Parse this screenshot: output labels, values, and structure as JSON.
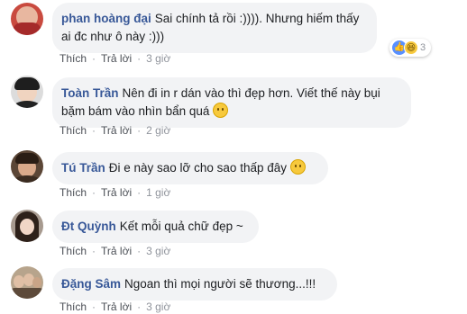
{
  "comments": [
    {
      "author": "phan hoàng đại",
      "text": "Sai chính tả rồi :)))). Nhưng hiếm thấy ai đc như ô này :)))",
      "like_label": "Thích",
      "reply_label": "Trả lời",
      "time": "3 giờ",
      "reaction_count": "3",
      "has_emoji": false,
      "avatar_color": "#b8352f"
    },
    {
      "author": "Toàn Trần",
      "text": "Nên đi in r dán vào thì đẹp hơn. Viết thế này bụi bặm bám vào nhìn bẩn quá",
      "like_label": "Thích",
      "reply_label": "Trả lời",
      "time": "2 giờ",
      "has_emoji": true,
      "avatar_color": "#2b2b2b"
    },
    {
      "author": "Tú Trần",
      "text": "Đi e này sao lỡ cho sao thấp đây",
      "like_label": "Thích",
      "reply_label": "Trả lời",
      "time": "1 giờ",
      "has_emoji": true,
      "avatar_color": "#6a4a3a"
    },
    {
      "author": "Đt Quỳnh",
      "text": "Kết mỗi quả chữ đẹp ~",
      "like_label": "Thích",
      "reply_label": "Trả lời",
      "time": "3 giờ",
      "has_emoji": false,
      "avatar_color": "#3c2b22"
    },
    {
      "author": "Đặng Sâm",
      "text": "Ngoan thì mọi người sẽ thương...!!!",
      "like_label": "Thích",
      "reply_label": "Trả lời",
      "time": "3 giờ",
      "has_emoji": false,
      "avatar_color": "#8a6d4e"
    }
  ],
  "colors": {
    "author": "#385898",
    "bubble": "#f2f3f5",
    "meta": "#90949c"
  }
}
